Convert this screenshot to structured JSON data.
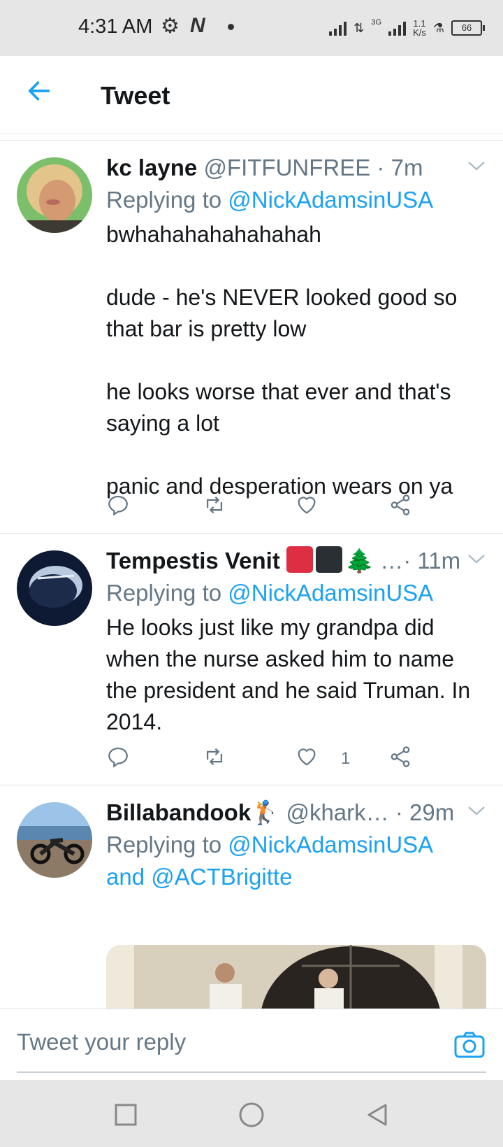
{
  "status_bar": {
    "time": "4:31 AM",
    "network": "3G",
    "speed_value": "1.1",
    "speed_unit": "K/s",
    "battery": "66"
  },
  "header": {
    "title": "Tweet",
    "back_icon": "arrow-left-icon",
    "accent_color": "#1da1f2"
  },
  "tweets": [
    {
      "name": "kc layne",
      "handle": "@FITFUNFREE",
      "sep": " · ",
      "time": "7m",
      "replying_label": "Replying to",
      "replying_to": "@NickAdamsinUSA",
      "text": "bwhahahahahahahah\n\ndude - he's NEVER looked good so that bar is pretty low\n\nhe looks worse that ever and that's saying a lot\n\npanic and desperation wears on ya"
    },
    {
      "name": "Tempestis Venit",
      "emojis": [
        "🟥",
        "⬛",
        "🌲"
      ],
      "handle": "…",
      "sep": "· ",
      "time": "11m",
      "replying_label": "Replying to",
      "replying_to": "@NickAdamsinUSA",
      "text": "He looks just like my grandpa did when the nurse asked him to name the president and he said Truman. In 2014.",
      "like_count": "1"
    },
    {
      "name": "Billabandook",
      "emoji": "🏌",
      "handle": "@khark…",
      "sep": " · ",
      "time": "29m",
      "replying_label": "Replying to",
      "replying_to": "@NickAdamsinUSA",
      "and_label": "and",
      "replying_to_2": "@ACTBrigitte"
    }
  ],
  "composer": {
    "placeholder": "Tweet your reply",
    "camera_icon": "camera-icon"
  },
  "navbar": {
    "icons": [
      "square-icon",
      "circle-icon",
      "triangle-back-icon"
    ]
  }
}
